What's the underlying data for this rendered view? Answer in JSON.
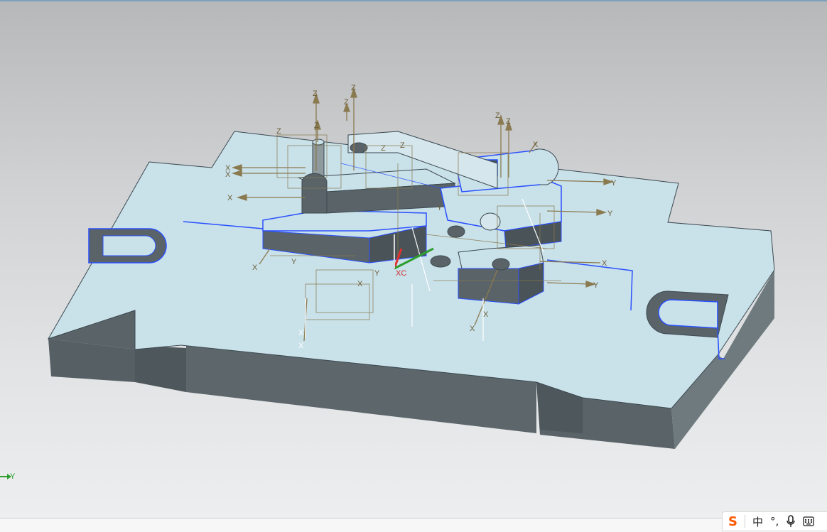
{
  "viewport": {
    "background_top": "#b6b8ba",
    "background_bottom": "#eceeef",
    "model_top_face_color": "#c9e1e9",
    "model_side_face_color": "#5a6468",
    "edge_highlight_color": "#2a50ff",
    "datum_color": "#8a7a50"
  },
  "wcs_triad": {
    "axis_label": "Y",
    "axis_color": "#2e9e2e"
  },
  "csys_labels": {
    "xc": "XC",
    "x": "X",
    "y": "Y",
    "z": "Z"
  },
  "ime_toolbar": {
    "logo_icon": "sogou-logo-icon",
    "logo_text": "S",
    "mode_label": "中",
    "punct_label": "°,",
    "mic_icon": "microphone-icon",
    "keyboard_icon": "keyboard-icon"
  }
}
